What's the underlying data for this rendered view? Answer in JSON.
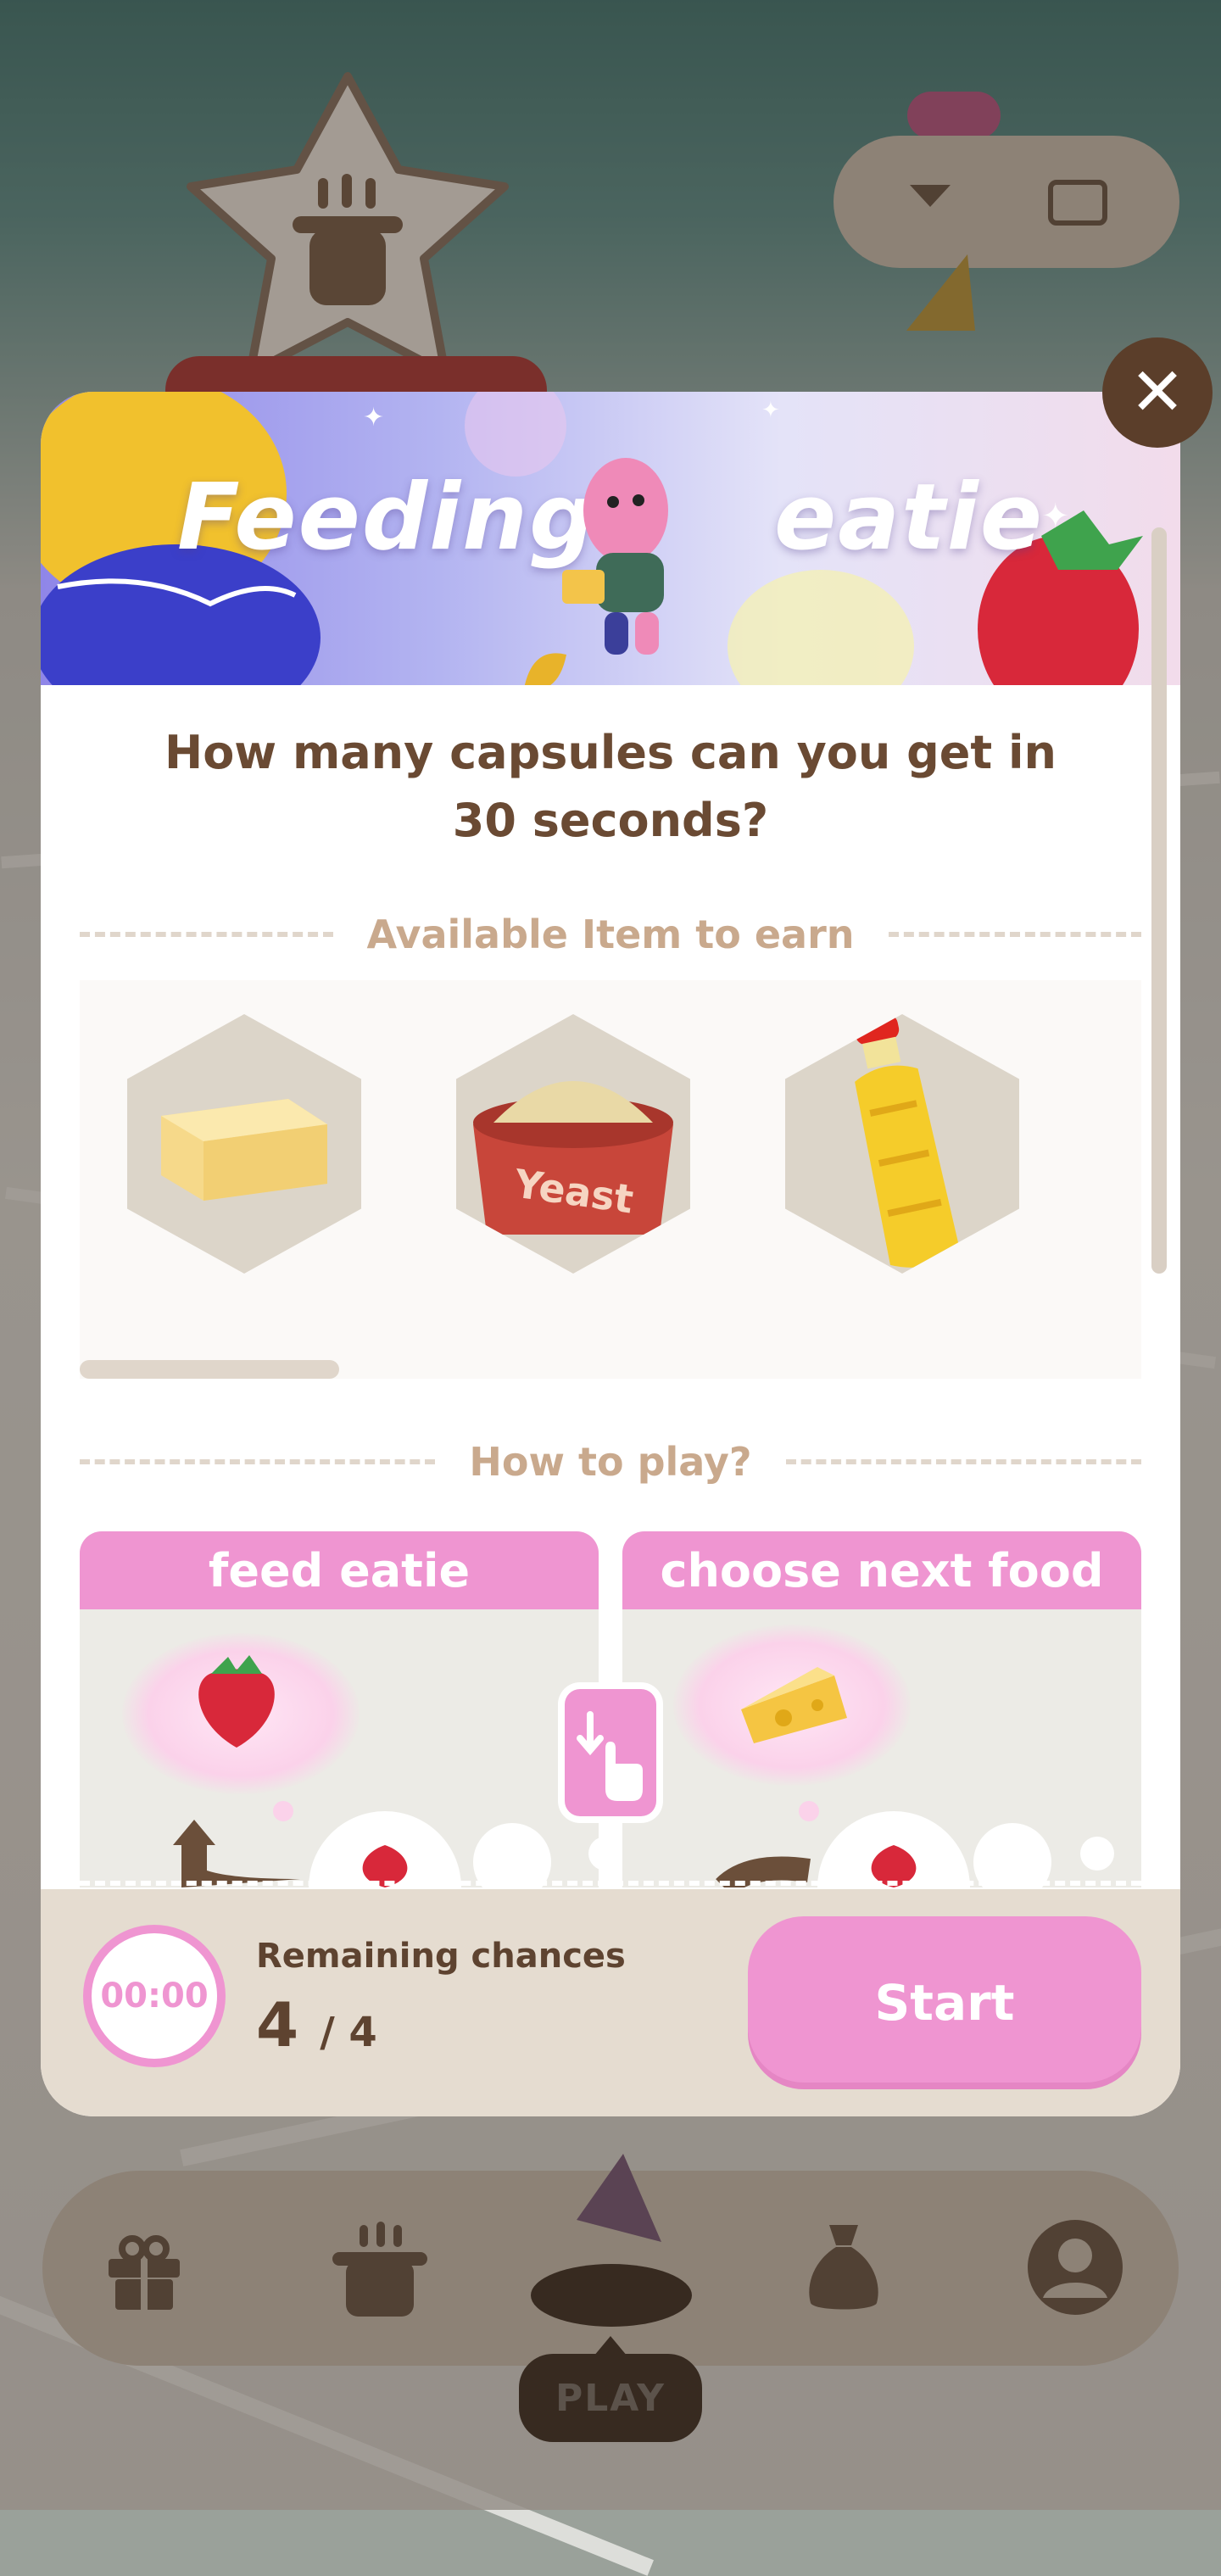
{
  "banner": {
    "title_left": "Feeding",
    "title_right": "eatie"
  },
  "question": "How many capsules can you get in 30 seconds?",
  "sections": {
    "available_items": "Available Item to earn",
    "how_to_play": "How to play?"
  },
  "items": [
    {
      "name": "butter-icon"
    },
    {
      "name": "yeast-box-icon",
      "label": "Yeast"
    },
    {
      "name": "oil-bottle-icon"
    }
  ],
  "cards": [
    {
      "title": "feed eatie"
    },
    {
      "title": "choose next food"
    }
  ],
  "footer": {
    "timer": "00:00",
    "remaining_label": "Remaining chances",
    "remaining_current": "4",
    "remaining_total": "/ 4",
    "start_label": "Start"
  },
  "close_symbol": "✕",
  "nav": {
    "items": [
      "gift-icon",
      "pot-icon",
      "play",
      "bag-icon",
      "profile-icon"
    ],
    "play_label": "PLAY"
  },
  "colors": {
    "accent_pink": "#ef95d1",
    "brown_text": "#6a4a33",
    "footer_bg": "#e5dcd0",
    "close_bg": "#5b3e2a"
  }
}
